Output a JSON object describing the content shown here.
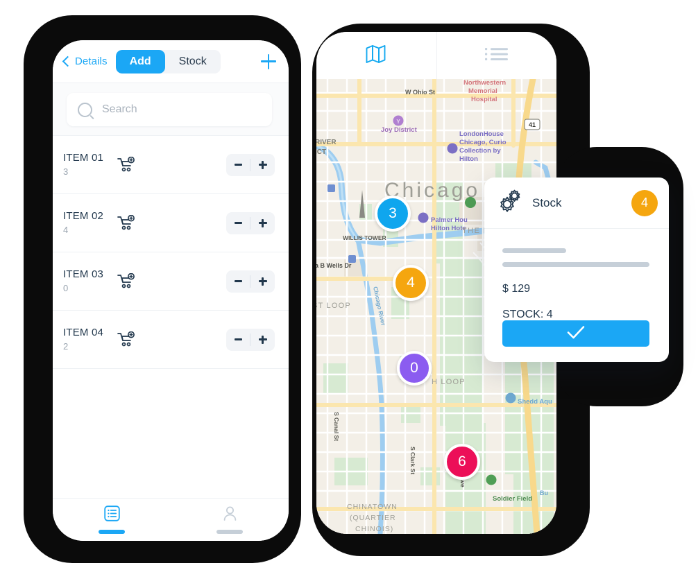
{
  "left_phone": {
    "header": {
      "back_label": "Details",
      "back_icon": "chevron-left-icon",
      "add_tab": "Add",
      "stock_tab": "Stock",
      "add_icon": "plus-icon"
    },
    "search": {
      "placeholder": "Search",
      "icon": "search-icon"
    },
    "items": [
      {
        "name": "ITEM 01",
        "qty": "3",
        "icon": "cart-plus-icon",
        "minus": "−",
        "plus": "+"
      },
      {
        "name": "ITEM 02",
        "qty": "4",
        "icon": "cart-plus-icon",
        "minus": "−",
        "plus": "+"
      },
      {
        "name": "ITEM 03",
        "qty": "0",
        "icon": "cart-plus-icon",
        "minus": "−",
        "plus": "+"
      },
      {
        "name": "ITEM 04",
        "qty": "2",
        "icon": "cart-plus-icon",
        "minus": "−",
        "plus": "+"
      }
    ],
    "tabbar": [
      {
        "icon": "list-icon",
        "state": "active"
      },
      {
        "icon": "person-icon",
        "state": "inactive"
      }
    ]
  },
  "right_phone": {
    "header": {
      "map_tab_icon": "map-icon",
      "list_tab_icon": "list-bullet-icon"
    },
    "map": {
      "city_label": "Chicago",
      "labels": [
        "W Ohio St",
        "Northwestern",
        "Memorial",
        "Hospital",
        "Joy District",
        "LondonHouse",
        "Chicago, Curio",
        "Collection by",
        "Hilton",
        "RIVER",
        "ICT",
        "41",
        "Palmer Hou",
        "Hilton Hote",
        "WILLIS TOWER",
        "THE LOOP",
        "a B Wells Dr",
        "ST LOOP",
        "Chicago River",
        "H LOOP",
        "Shedd Aqu",
        "S Canal St",
        "S Clark St",
        "chigan Ave",
        "Soldier Field",
        "CHINATOWN",
        "(QUARTIER",
        "CHINOIS)"
      ],
      "markers": [
        {
          "value": "3",
          "color": "#0fa6ee"
        },
        {
          "value": "4",
          "color": "#f5a60f"
        },
        {
          "value": "0",
          "color": "#8b5cf0"
        },
        {
          "value": "6",
          "color": "#ec0f58"
        }
      ]
    }
  },
  "popup": {
    "icon": "gears-icon",
    "title": "Stock",
    "badge": "4",
    "badge_color": "#f5a60f",
    "price": "$ 129",
    "stock": "STOCK: 4",
    "confirm_icon": "check-icon"
  },
  "colors": {
    "accent_blue": "#1ba7f5",
    "dark_navy": "#22384d",
    "muted_grey": "#9aa5b0"
  }
}
